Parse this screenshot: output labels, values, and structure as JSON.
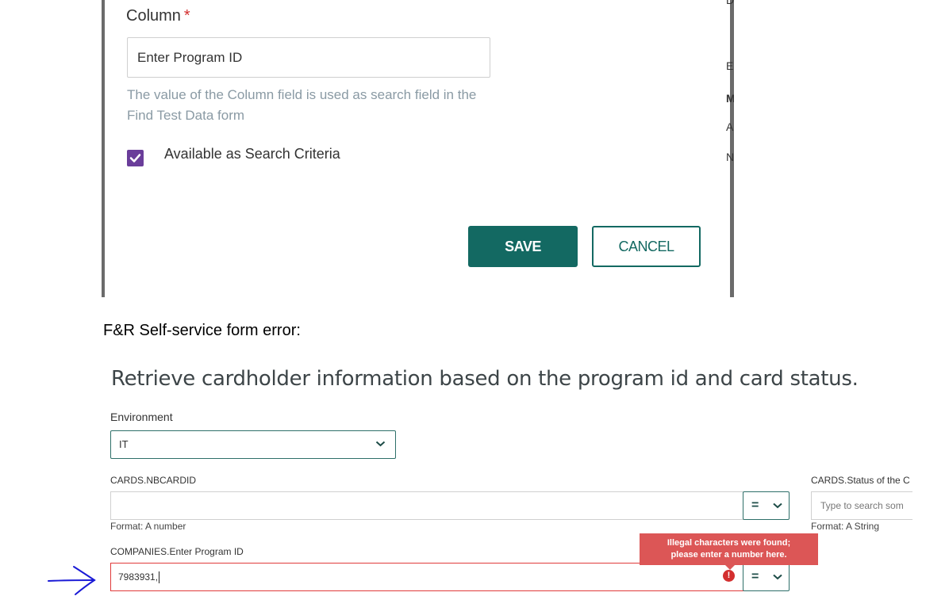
{
  "dialog": {
    "column_label": "Column",
    "required_marker": "*",
    "column_value": "Enter Program ID",
    "help_text": "The value of the Column field is used as search field in the Find Test Data form",
    "checkbox_label": "Available as Search Criteria",
    "checkbox_checked": true,
    "save_label": "SAVE",
    "cancel_label": "CANCEL",
    "background_glyphs": [
      "D",
      "E",
      "M",
      "A",
      "N"
    ]
  },
  "caption": "F&R Self-service form error:",
  "form": {
    "title": "Retrieve cardholder information based on the program id and card status.",
    "environment": {
      "label": "Environment",
      "selected": "IT"
    },
    "fields": [
      {
        "label": "CARDS.NBCARDID",
        "value": "",
        "format": "Format: A number",
        "operator": "="
      },
      {
        "label": "COMPANIES.Enter Program ID",
        "value": "7983931,",
        "operator": "=",
        "error": "Illegal characters were found; please enter a number here."
      },
      {
        "label": "CARDS.Status of the C",
        "placeholder": "Type to search som",
        "format": "Format: A String"
      }
    ],
    "error_tooltip_line1": "Illegal characters were found;",
    "error_tooltip_line2": "please enter a number here.",
    "error_icon": "!"
  },
  "colors": {
    "primary": "#136962",
    "checkbox": "#6a3d9a",
    "error": "#dc5656",
    "required": "#d32f2f",
    "annotation_arrow": "#1a1ad6"
  }
}
